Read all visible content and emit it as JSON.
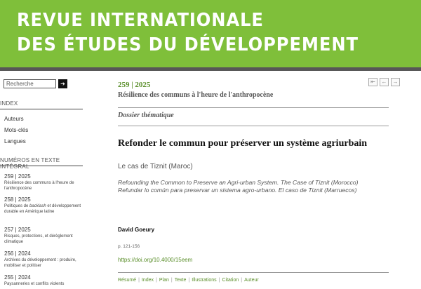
{
  "banner": {
    "line1": "REVUE INTERNATIONALE",
    "line2": "DES ÉTUDES DU DÉVELOPPEMENT"
  },
  "sidebar": {
    "search_placeholder": "Recherche",
    "search_button": "➔",
    "index_heading": "INDEX",
    "index_items": [
      "Auteurs",
      "Mots-clés",
      "Langues"
    ],
    "issues_heading": "NUMÉROS EN TEXTE INTÉGRAL",
    "issues": [
      {
        "number": "259 | 2025",
        "desc_before": "Résilience des communs à l'heure de l'anthropocène",
        "desc_em": "",
        "desc_after": ""
      },
      {
        "number": "258 | 2025",
        "desc_before": "Politiques de ",
        "desc_em": "backlash",
        "desc_after": " et développement durable en Amérique latine"
      },
      {
        "number": "257 | 2025",
        "desc_before": "Risques, protections, et dérèglement climatique",
        "desc_em": "",
        "desc_after": ""
      },
      {
        "number": "256 | 2024",
        "desc_before": "Archives du développement : produire, mobiliser et politiser",
        "desc_em": "",
        "desc_after": ""
      },
      {
        "number": "255 | 2024",
        "desc_before": "Paysanneries et conflits violents",
        "desc_em": "",
        "desc_after": ""
      }
    ]
  },
  "main": {
    "nav": {
      "first": "⇤",
      "prev": "←",
      "next": "→"
    },
    "issue_number": "259 | 2025",
    "issue_title": "Résilience des communs à l'heure de l'anthropocène",
    "section": "Dossier thématique",
    "article_title": "Refonder le commun pour préserver un système agriurbain",
    "article_subtitle": "Le cas de Tiznit (Maroc)",
    "alt_title_en": "Refounding the Common to Preserve an Agri-urban System. The Case of Tiznit (Morocco)",
    "alt_title_es": "Refundar lo común para preservar un sistema agro-urbano. El caso de Tiznit (Marruecos)",
    "author": "David Goeury",
    "pages": "p. 121-156",
    "doi": "https://doi.org/10.4000/15eem",
    "footer_links": [
      "Résumé",
      "Index",
      "Plan",
      "Texte",
      "Illustrations",
      "Citation",
      "Auteur"
    ]
  },
  "colors": {
    "banner": "#7fbf3a",
    "accent": "#5a8e2a"
  }
}
